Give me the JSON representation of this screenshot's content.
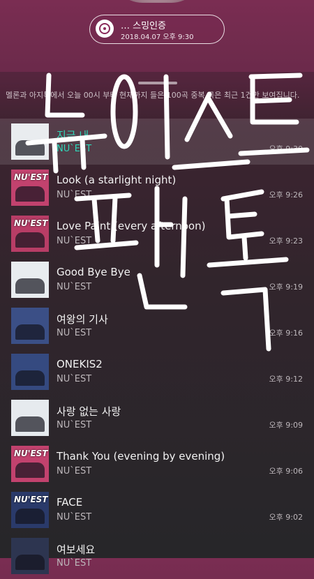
{
  "badge": {
    "title": "… 스밍인증",
    "date": "2018.04.07 오후 9:30"
  },
  "notice": "멜론과 아지톡에서 오늘 00시 부터 현재까지 들은 100곡 중복 곡은 최근 1건만 보여집니다.",
  "tracks": [
    {
      "title": "지금 내",
      "artist": "NU`EST",
      "time": "오후 9:30",
      "cover": "#e9ecef",
      "cover_label": ""
    },
    {
      "title": "Look (a starlight night)",
      "artist": "NU`EST",
      "time": "오후 9:26",
      "cover": "#c2426e",
      "cover_label": "NU'EST"
    },
    {
      "title": "Love Paint (every afternoon)",
      "artist": "NU`EST",
      "time": "오후 9:23",
      "cover": "#b83d66",
      "cover_label": "NU'EST"
    },
    {
      "title": "Good Bye Bye",
      "artist": "NU`EST",
      "time": "오후 9:19",
      "cover": "#e8ecef",
      "cover_label": ""
    },
    {
      "title": "여왕의 기사",
      "artist": "NU`EST",
      "time": "오후 9:16",
      "cover": "#3b4f86",
      "cover_label": ""
    },
    {
      "title": "ONEKIS2",
      "artist": "NU`EST",
      "time": "오후 9:12",
      "cover": "#354a80",
      "cover_label": ""
    },
    {
      "title": "사랑 없는 사랑",
      "artist": "NU`EST",
      "time": "오후 9:09",
      "cover": "#e6eaee",
      "cover_label": ""
    },
    {
      "title": "Thank You (evening by evening)",
      "artist": "NU`EST",
      "time": "오후 9:06",
      "cover": "#c2426e",
      "cover_label": "NU'EST"
    },
    {
      "title": "FACE",
      "artist": "NU`EST",
      "time": "오후 9:02",
      "cover": "#2a3a6a",
      "cover_label": "NU'EST"
    },
    {
      "title": "여보세요",
      "artist": "NU`EST",
      "time": "",
      "cover": "#2d3550",
      "cover_label": ""
    }
  ],
  "handwriting": "뉴이스트 편톡",
  "colors": {
    "accent_highlight": "#2fd6b8",
    "background_top": "#7a2d52"
  }
}
